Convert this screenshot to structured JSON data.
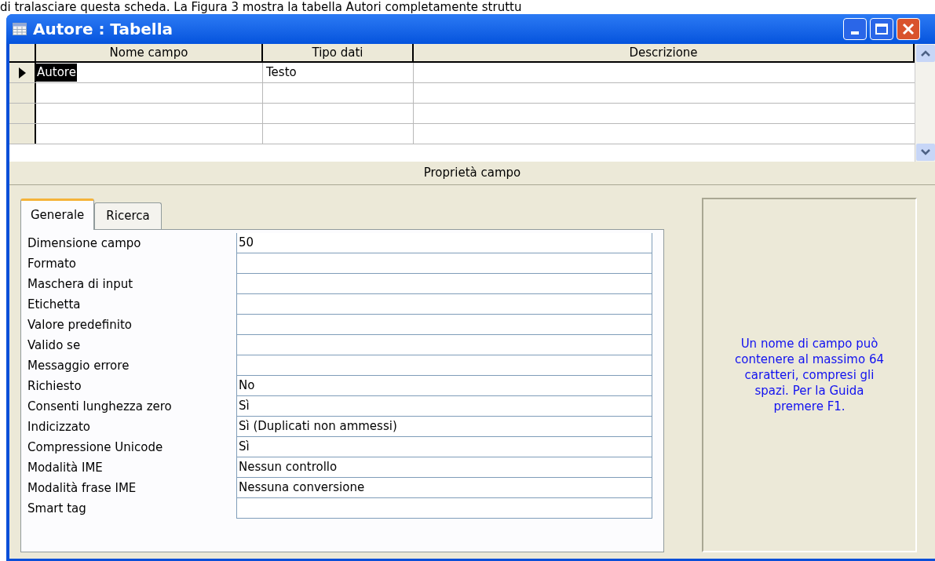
{
  "caption": "di tralasciare questa scheda. La Figura 3 mostra la tabella Autori completamente struttu",
  "window": {
    "title": "Autore : Tabella"
  },
  "grid": {
    "columns": [
      "Nome campo",
      "Tipo dati",
      "Descrizione"
    ],
    "rows": [
      {
        "current": true,
        "name_selected": true,
        "field_name": "Autore",
        "data_type": "Testo"
      }
    ]
  },
  "properties_header": "Proprietà campo",
  "tabs": [
    {
      "label": "Generale",
      "selected": true
    },
    {
      "label": "Ricerca",
      "selected": false
    }
  ],
  "properties": [
    {
      "label": "Dimensione campo",
      "value": "50"
    },
    {
      "label": "Formato"
    },
    {
      "label": "Maschera di input"
    },
    {
      "label": "Etichetta"
    },
    {
      "label": "Valore predefinito"
    },
    {
      "label": "Valido se"
    },
    {
      "label": "Messaggio errore"
    },
    {
      "label": "Richiesto",
      "value": "No"
    },
    {
      "label": "Consenti lunghezza zero",
      "value": "Sì"
    },
    {
      "label": "Indicizzato",
      "value": "Sì (Duplicati non ammessi)"
    },
    {
      "label": "Compressione Unicode",
      "value": "Sì"
    },
    {
      "label": "Modalità IME",
      "value": "Nessun controllo"
    },
    {
      "label": "Modalità frase IME",
      "value": "Nessuna conversione"
    },
    {
      "label": "Smart tag"
    }
  ],
  "help_text": "Un nome di campo può contenere al massimo 64 caratteri, compresi gli spazi. Per la Guida premere F1."
}
